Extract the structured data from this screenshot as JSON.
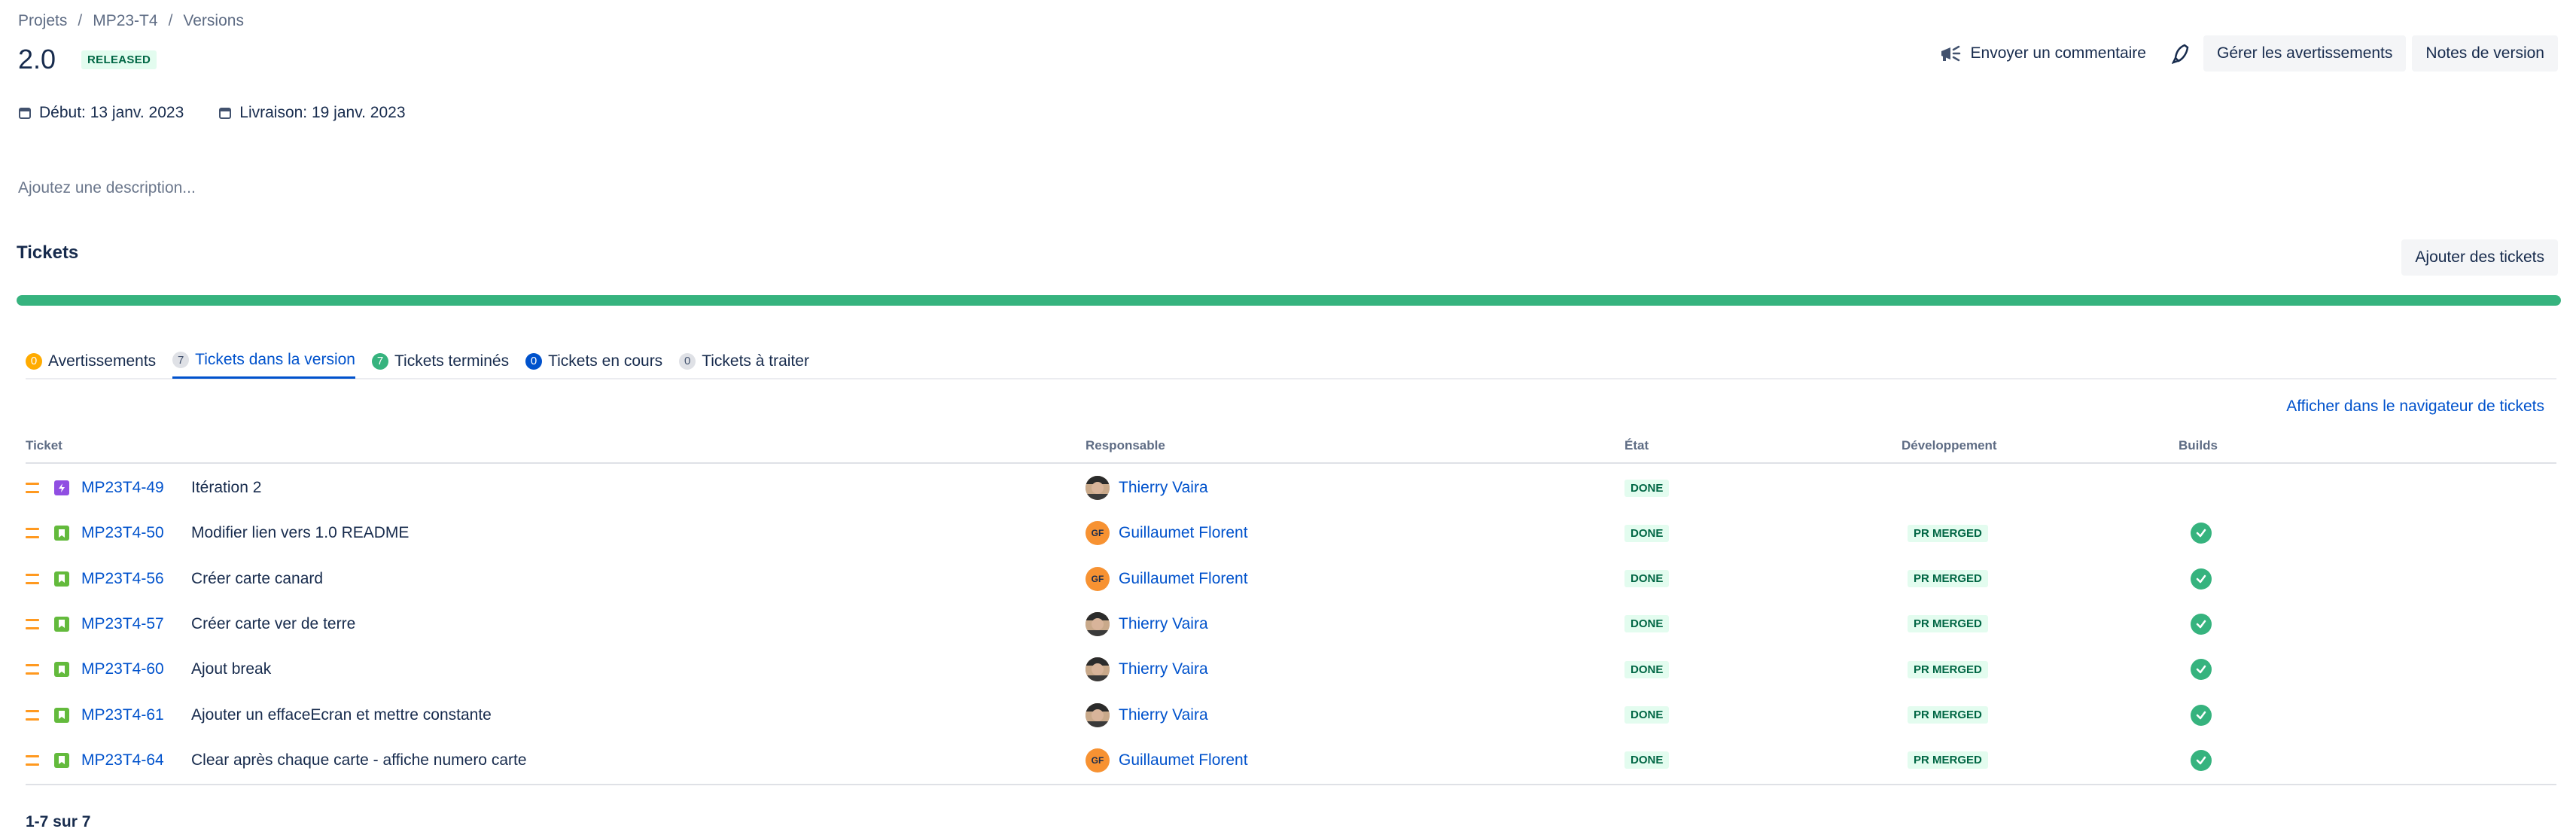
{
  "breadcrumb": {
    "items": [
      "Projets",
      "MP23-T4",
      "Versions"
    ],
    "separator": "/"
  },
  "version": {
    "name": "2.0",
    "status": "RELEASED"
  },
  "header_actions": {
    "feedback": "Envoyer un commentaire",
    "manage_warnings": "Gérer les avertissements",
    "release_notes": "Notes de version"
  },
  "dates": {
    "start": "Début: 13 janv. 2023",
    "delivery": "Livraison: 19 janv. 2023"
  },
  "description_placeholder": "Ajoutez une description...",
  "tickets": {
    "title": "Tickets",
    "add_button": "Ajouter des tickets",
    "progress_done_fraction": 1.0,
    "tabs": [
      {
        "count": "0",
        "label": "Avertissements"
      },
      {
        "count": "7",
        "label": "Tickets dans la version"
      },
      {
        "count": "7",
        "label": "Tickets terminés"
      },
      {
        "count": "0",
        "label": "Tickets en cours"
      },
      {
        "count": "0",
        "label": "Tickets à traiter"
      }
    ],
    "navigator_link": "Afficher dans le navigateur de tickets",
    "columns": {
      "ticket": "Ticket",
      "assignee": "Responsable",
      "state": "État",
      "development": "Développement",
      "builds": "Builds"
    },
    "rows": [
      {
        "key": "MP23T4-49",
        "summary": "Itération 2",
        "assignee": "Thierry Vaira",
        "state": "DONE",
        "dev": "",
        "type": "epic"
      },
      {
        "key": "MP23T4-50",
        "summary": "Modifier lien vers 1.0 README",
        "assignee": "Guillaumet Florent",
        "state": "DONE",
        "dev": "PR MERGED",
        "type": "story"
      },
      {
        "key": "MP23T4-56",
        "summary": "Créer carte canard",
        "assignee": "Guillaumet Florent",
        "state": "DONE",
        "dev": "PR MERGED",
        "type": "story"
      },
      {
        "key": "MP23T4-57",
        "summary": "Créer carte ver de terre",
        "assignee": "Thierry Vaira",
        "state": "DONE",
        "dev": "PR MERGED",
        "type": "story"
      },
      {
        "key": "MP23T4-60",
        "summary": "Ajout break",
        "assignee": "Thierry Vaira",
        "state": "DONE",
        "dev": "PR MERGED",
        "type": "story"
      },
      {
        "key": "MP23T4-61",
        "summary": "Ajouter un effaceEcran et mettre constante",
        "assignee": "Thierry Vaira",
        "state": "DONE",
        "dev": "PR MERGED",
        "type": "story"
      },
      {
        "key": "MP23T4-64",
        "summary": "Clear après chaque carte - affiche numero carte",
        "assignee": "Guillaumet Florent",
        "state": "DONE",
        "dev": "PR MERGED",
        "type": "story"
      }
    ],
    "avatar_initials": {
      "Guillaumet Florent": "GF"
    },
    "pagination": "1-7 sur 7"
  },
  "colors": {
    "accent": "#0052cc",
    "done": "#36b37e",
    "priority_medium": "#ff991f"
  }
}
